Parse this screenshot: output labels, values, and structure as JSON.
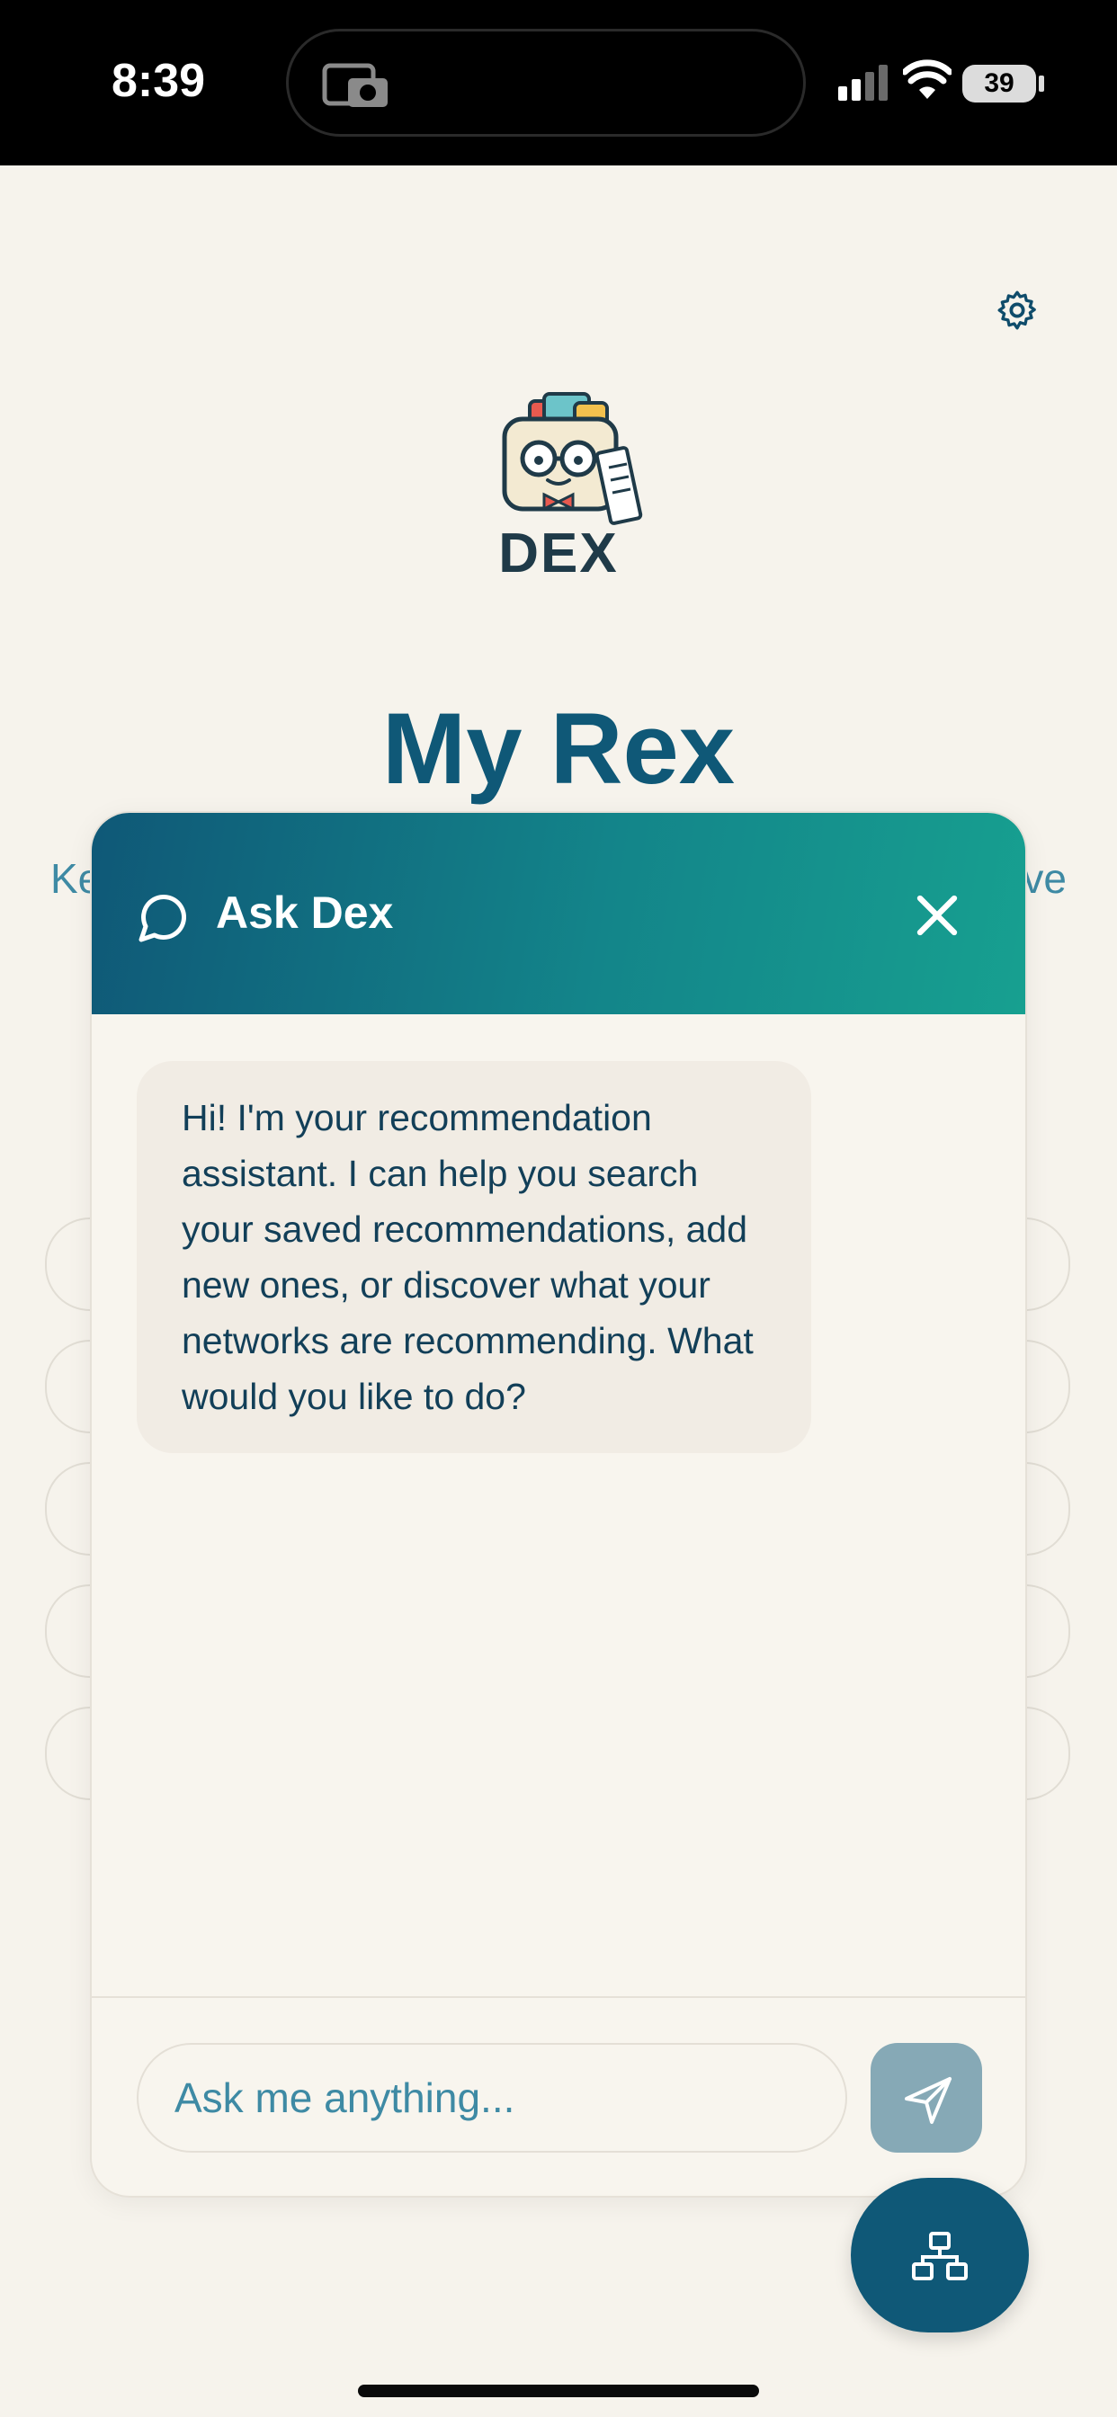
{
  "status_bar": {
    "time": "8:39",
    "battery": "39"
  },
  "app": {
    "logo_text": "DEX",
    "page_title": "My Rex",
    "subtitle_left": "Ke",
    "subtitle_right": "ve"
  },
  "chat": {
    "title": "Ask Dex",
    "messages": [
      {
        "role": "assistant",
        "text": "Hi! I'm your recommendation assistant. I can help you search your saved recommendations, add new ones, or discover what your networks are recommending. What would you like to do?"
      }
    ],
    "input_placeholder": "Ask me anything..."
  },
  "icons": {
    "settings": "gear-icon",
    "chat": "chat-bubble-icon",
    "close": "close-icon",
    "send": "send-icon",
    "fab": "network-icon"
  },
  "colors": {
    "accent": "#0f5877",
    "header_gradient_end": "#17a090",
    "background": "#f6f3ec"
  }
}
